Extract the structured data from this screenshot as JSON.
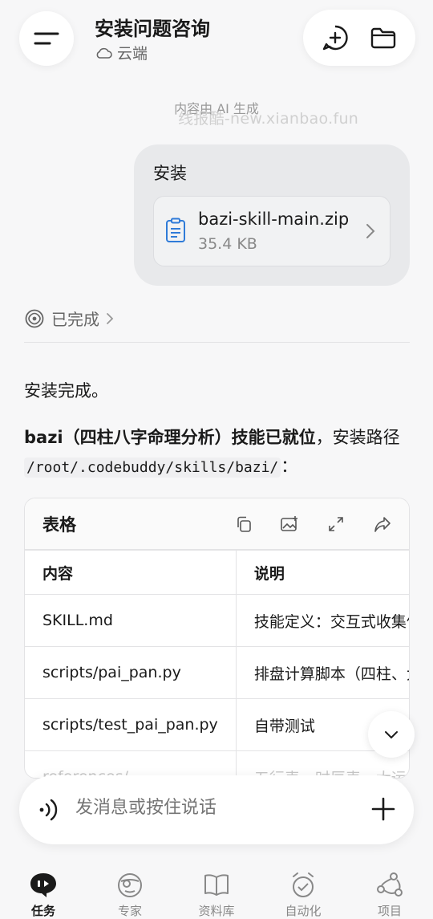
{
  "header": {
    "title": "安装问题咨询",
    "subtitle": "云端"
  },
  "ai_note": "内容由 AI 生成",
  "watermark": "线报酷-new.xianbao.fun",
  "user_message": {
    "text": "安装",
    "file": {
      "name": "bazi-skill-main.zip",
      "size": "35.4 KB"
    }
  },
  "status": {
    "label": "已完成"
  },
  "response": {
    "line1": "安装完成。",
    "bold": "bazi（四柱八字命理分析）技能已就位",
    "mid": "，安装路径 ",
    "path": "/root/.codebuddy/skills/bazi/",
    "tail": "："
  },
  "table": {
    "title": "表格",
    "headers": [
      "内容",
      "说明"
    ],
    "rows": [
      [
        "SKILL.md",
        "技能定义：交互式收集信息"
      ],
      [
        "scripts/pai_pan.py",
        "排盘计算脚本（四柱、大运"
      ],
      [
        "scripts/test_pai_pan.py",
        "自带测试"
      ],
      [
        "references/",
        "五行表、时辰表、大运规则"
      ]
    ]
  },
  "input": {
    "placeholder": "发消息或按住说话"
  },
  "tabs": [
    {
      "label": "任务",
      "icon": "task-icon",
      "active": true
    },
    {
      "label": "专家",
      "icon": "expert-icon",
      "active": false
    },
    {
      "label": "资料库",
      "icon": "library-icon",
      "active": false
    },
    {
      "label": "自动化",
      "icon": "automation-icon",
      "active": false
    },
    {
      "label": "项目",
      "icon": "project-icon",
      "active": false
    }
  ],
  "colors": {
    "accent": "#1a1a1a",
    "background": "#f7f7f8",
    "bubble": "#e8e9eb"
  }
}
